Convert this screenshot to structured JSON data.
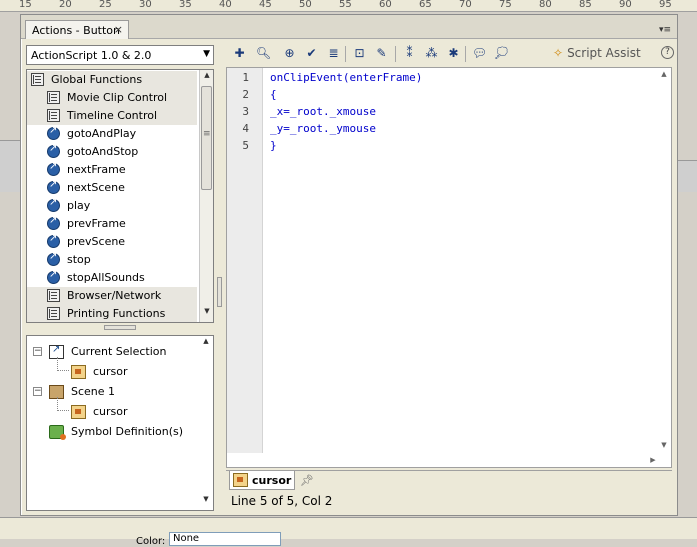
{
  "ruler": {
    "ticks": [
      "15",
      "20",
      "25",
      "30",
      "35",
      "40",
      "45",
      "50",
      "55",
      "60",
      "65",
      "70",
      "75",
      "80",
      "85",
      "90",
      "95"
    ]
  },
  "panel": {
    "tab_title": "Actions - Button",
    "close_glyph": "×",
    "menu_glyph": "▾≡"
  },
  "version_select": {
    "value": "ActionScript 1.0 & 2.0"
  },
  "toolbox": {
    "items": [
      {
        "label": "Global Functions",
        "kind": "book",
        "level": 0,
        "category": true
      },
      {
        "label": "Movie Clip Control",
        "kind": "book",
        "level": 1,
        "category": true
      },
      {
        "label": "Timeline Control",
        "kind": "book",
        "level": 1,
        "category": true
      },
      {
        "label": "gotoAndPlay",
        "kind": "fn",
        "level": 2,
        "category": false
      },
      {
        "label": "gotoAndStop",
        "kind": "fn",
        "level": 2,
        "category": false
      },
      {
        "label": "nextFrame",
        "kind": "fn",
        "level": 2,
        "category": false
      },
      {
        "label": "nextScene",
        "kind": "fn",
        "level": 2,
        "category": false
      },
      {
        "label": "play",
        "kind": "fn",
        "level": 2,
        "category": false
      },
      {
        "label": "prevFrame",
        "kind": "fn",
        "level": 2,
        "category": false
      },
      {
        "label": "prevScene",
        "kind": "fn",
        "level": 2,
        "category": false
      },
      {
        "label": "stop",
        "kind": "fn",
        "level": 2,
        "category": false
      },
      {
        "label": "stopAllSounds",
        "kind": "fn",
        "level": 2,
        "category": false
      },
      {
        "label": "Browser/Network",
        "kind": "book",
        "level": 1,
        "category": true
      },
      {
        "label": "Printing Functions",
        "kind": "book",
        "level": 1,
        "category": true
      }
    ]
  },
  "navigator": {
    "items": [
      {
        "label": "Current Selection",
        "icon": "selection-icon",
        "toggle": "−"
      },
      {
        "label": "cursor",
        "icon": "movieclip-icon",
        "toggle": ""
      },
      {
        "label": "Scene 1",
        "icon": "scene-icon",
        "toggle": "−"
      },
      {
        "label": "cursor",
        "icon": "movieclip-icon",
        "toggle": ""
      },
      {
        "label": "Symbol Definition(s)",
        "icon": "symbol-icon",
        "toggle": ""
      }
    ]
  },
  "toolbar": {
    "script_assist_label": "Script Assist",
    "help_glyph": "?"
  },
  "editor": {
    "lines": [
      {
        "num": "1",
        "code": "onClipEvent(enterFrame)"
      },
      {
        "num": "2",
        "code": "{"
      },
      {
        "num": "3",
        "code": "_x=_root._xmouse"
      },
      {
        "num": "4",
        "code": "_y=_root._ymouse"
      },
      {
        "num": "5",
        "code": "}"
      }
    ]
  },
  "script_tab": {
    "label": "cursor"
  },
  "status": {
    "text": "Line 5 of 5, Col 2"
  },
  "stage": {
    "color_label": "Color:",
    "color_value": "None"
  },
  "colors": {
    "code": "#0000cc",
    "panel_bg": "#ece9d8",
    "function_icon": "#2a5fa6"
  }
}
